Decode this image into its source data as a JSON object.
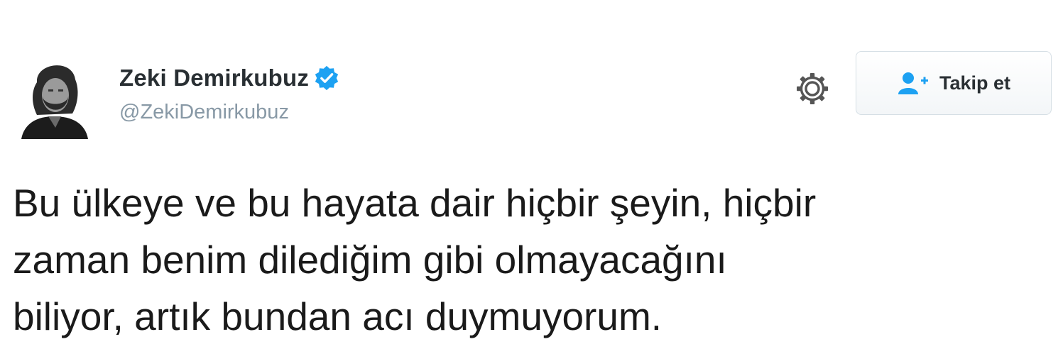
{
  "author": {
    "display_name": "Zeki Demirkubuz",
    "handle": "@ZekiDemirkubuz",
    "verified": true,
    "avatar_icon": "profile-photo"
  },
  "actions": {
    "settings_icon": "gear-icon",
    "follow_icon": "add-user-icon",
    "follow_label": "Takip et"
  },
  "tweet": {
    "lines": [
      "Bu ülkeye ve bu hayata dair hiçbir şeyin, hiçbir",
      "zaman benim dilediğim gibi olmayacağını",
      "biliyor, artık bundan acı duymuyorum."
    ]
  },
  "colors": {
    "verified_badge": "#1da1f2",
    "follow_icon": "#1da1f2",
    "handle": "#8899a6",
    "gear": "#555555"
  }
}
